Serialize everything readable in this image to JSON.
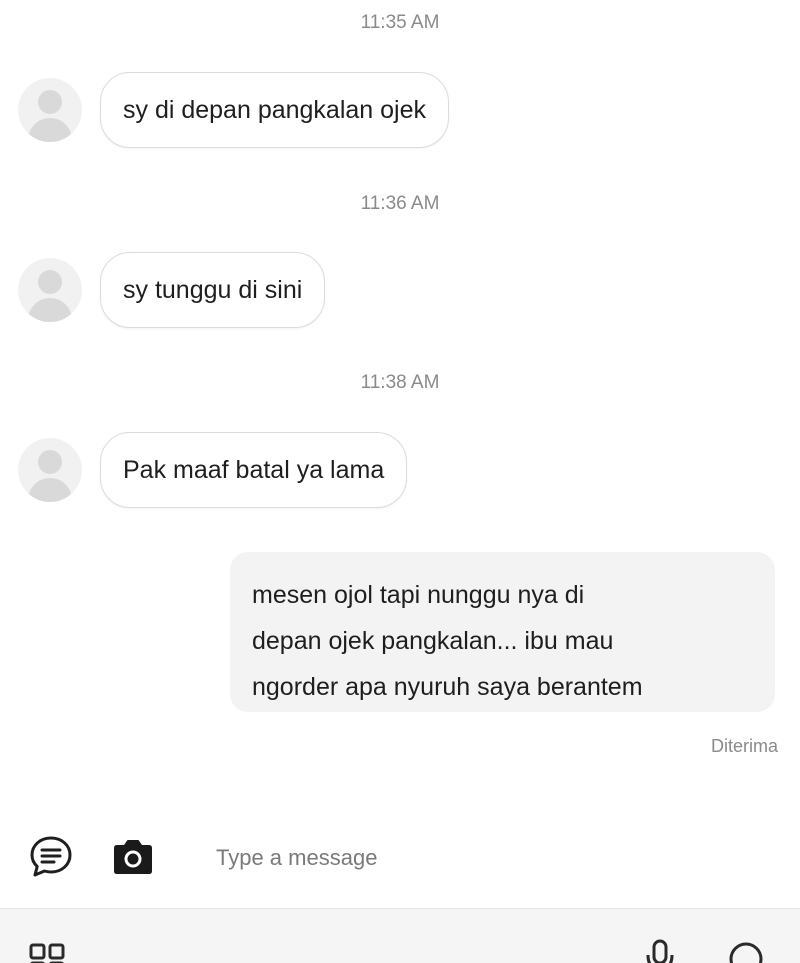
{
  "conversation": {
    "messages": [
      {
        "time": "11:35 AM",
        "text": "sy di depan pangkalan ojek"
      },
      {
        "time": "11:36 AM",
        "text": "sy tunggu di sini"
      },
      {
        "time": "11:38 AM",
        "text": "Pak maaf batal ya lama"
      }
    ],
    "reply": {
      "lines": [
        "mesen ojol tapi nunggu nya di",
        "depan ojek pangkalan... ibu mau",
        "ngorder apa nyuruh saya berantem"
      ],
      "status": "Diterima"
    }
  },
  "composer": {
    "placeholder": "Type a message",
    "icons": [
      "chat-bubble-icon",
      "camera-icon"
    ]
  },
  "bottom_bar": {
    "icons": [
      "apps-grid-icon",
      "microphone-icon",
      "emoji-icon"
    ]
  },
  "colors": {
    "incoming_border": "#dcdcdc",
    "outgoing_background": "#f3f3f3",
    "timestamp": "#8a8a8a",
    "avatar_placeholder": "#d9d9d9"
  }
}
